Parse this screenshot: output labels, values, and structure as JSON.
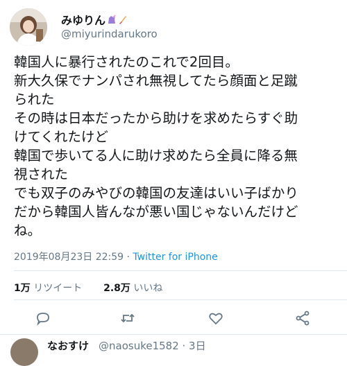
{
  "user": {
    "display_name": "みゆりん",
    "handle": "@miyurindarukoro"
  },
  "tweet": {
    "lines": [
      "韓国人に暴行されたのこれで2回目。",
      "新大久保でナンパされ無視してたら顔面と足蹴",
      "られた",
      "その時は日本だったから助けを求めたらすぐ助",
      "けてくれたけど",
      "韓国で歩いてる人に助け求めたら全員に降る無",
      "視された",
      "でも双子のみやびの韓国の友達はいい子ばかり",
      "だから韓国人皆んなが悪い国じゃないんだけど",
      "ね。"
    ],
    "timestamp": "2019年08月23日 22:59",
    "separator": " · ",
    "source": "Twitter for iPhone"
  },
  "stats": {
    "retweets_count": "1万",
    "retweets_label": "リツイート",
    "likes_count": "2.8万",
    "likes_label": "いいね"
  },
  "reply_preview": {
    "display_name": "なおすけ",
    "handle_time": "@naosuke1582 · 3日"
  },
  "icons": [
    "reply-icon",
    "retweet-icon",
    "like-icon",
    "share-icon"
  ],
  "colors": {
    "link": "#1b95e0",
    "secondary": "#657786",
    "text": "#14171a",
    "divider": "#e1e8ed"
  }
}
